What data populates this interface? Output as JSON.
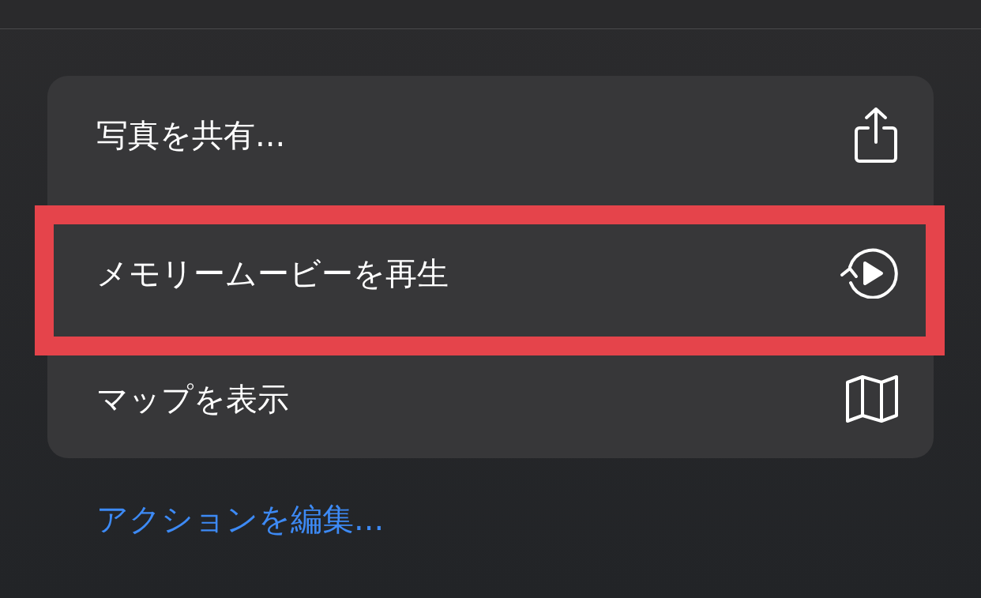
{
  "actions": [
    {
      "label": "写真を共有...",
      "kind": "share",
      "highlighted": false
    },
    {
      "label": "メモリームービーを再生",
      "kind": "replay",
      "highlighted": true
    },
    {
      "label": "マップを表示",
      "kind": "map",
      "highlighted": false
    }
  ],
  "edit_link": "アクションを編集..."
}
